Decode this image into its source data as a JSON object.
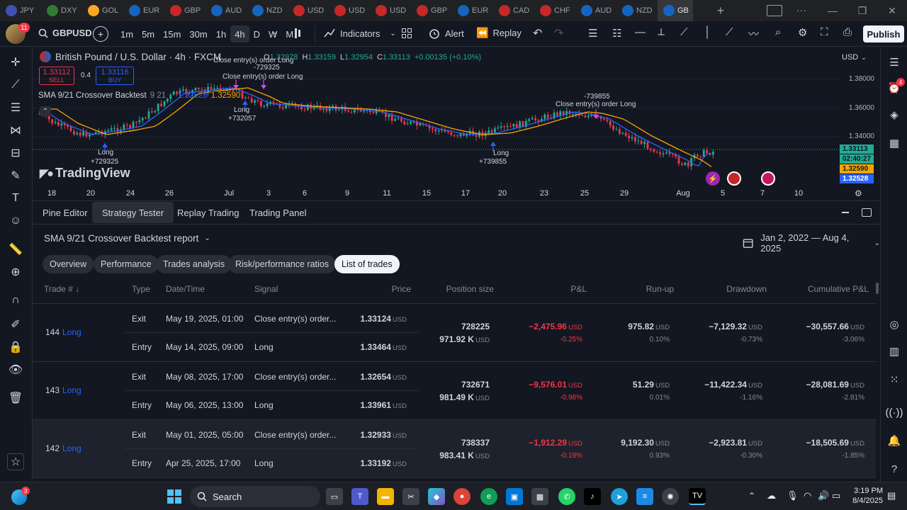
{
  "browser": {
    "tabs": [
      {
        "label": "JPY",
        "color": "#3f51b5"
      },
      {
        "label": "DXY",
        "color": "#2e7d32"
      },
      {
        "label": "GOL",
        "color": "#f9a825"
      },
      {
        "label": "EUR",
        "color": "#1565c0"
      },
      {
        "label": "GBP",
        "color": "#c62828"
      },
      {
        "label": "AUD",
        "color": "#1565c0"
      },
      {
        "label": "NZD",
        "color": "#1565c0"
      },
      {
        "label": "USD",
        "color": "#c62828"
      },
      {
        "label": "USD",
        "color": "#c62828"
      },
      {
        "label": "USD",
        "color": "#c62828"
      },
      {
        "label": "GBP",
        "color": "#c62828"
      },
      {
        "label": "EUR",
        "color": "#1565c0"
      },
      {
        "label": "CAD",
        "color": "#c62828"
      },
      {
        "label": "CHF",
        "color": "#c62828"
      },
      {
        "label": "AUD",
        "color": "#1565c0"
      },
      {
        "label": "NZD",
        "color": "#1565c0"
      },
      {
        "label": "GB",
        "color": "#1565c0"
      }
    ],
    "new_tab": "+",
    "minimize": "—",
    "maximize": "❐",
    "close": "✕"
  },
  "toolbar": {
    "symbol": "GBPUSD",
    "avatar_badge": "11",
    "timeframes": [
      "1m",
      "5m",
      "15m",
      "30m",
      "1h",
      "4h",
      "D",
      "W",
      "M"
    ],
    "active_timeframe": "4h",
    "indicators": "Indicators",
    "alert": "Alert",
    "replay": "Replay",
    "publish": "Publish"
  },
  "chart": {
    "title": "British Pound / U.S. Dollar · 4h · FXCM",
    "ohlc": {
      "o": "1.32978",
      "h": "1.33159",
      "l": "1.32954",
      "c": "1.33113",
      "change": "+0.00135 (+0.10%)"
    },
    "sell_price": "1.33112",
    "sell_label": "SELL",
    "spread": "0.4",
    "buy_price": "1.33116",
    "buy_label": "BUY",
    "strategy_name": "SMA 9/21 Crossover Backtest",
    "strategy_params": "9 21",
    "strategy_value1": "1.32528",
    "strategy_value2": "1.32590",
    "currency": "USD",
    "price_ticks": [
      "1.38000",
      "1.36000",
      "1.34000"
    ],
    "price_badges": [
      {
        "value": "1.33113",
        "color": "#22ab94"
      },
      {
        "value": "02:40:27",
        "color": "#22ab94"
      },
      {
        "value": "1.32590",
        "color": "#f7a600"
      },
      {
        "value": "1.32528",
        "color": "#2962ff"
      }
    ],
    "date_ticks": [
      "18",
      "20",
      "24",
      "26",
      "Jul",
      "3",
      "6",
      "9",
      "11",
      "15",
      "17",
      "20",
      "23",
      "25",
      "29",
      "Aug",
      "5",
      "7",
      "10"
    ],
    "annotations": [
      {
        "text": "Close entry(s) order Long",
        "kind": "close"
      },
      {
        "text": "-729325",
        "kind": "close"
      },
      {
        "text": "Close entry(s) order Long",
        "kind": "close"
      },
      {
        "text": "Long",
        "kind": "long"
      },
      {
        "text": "+732057",
        "kind": "long"
      },
      {
        "text": "Long",
        "kind": "long"
      },
      {
        "text": "+729325",
        "kind": "long"
      },
      {
        "text": "Long",
        "kind": "long"
      },
      {
        "text": "+739855",
        "kind": "long"
      },
      {
        "text": "-739855",
        "kind": "close"
      },
      {
        "text": "Close entry(s) order Long",
        "kind": "close"
      }
    ],
    "watermark": "TradingView"
  },
  "panel": {
    "tabs": [
      "Pine Editor",
      "Strategy Tester",
      "Replay Trading",
      "Trading Panel"
    ],
    "active_tab": "Strategy Tester",
    "report_title": "SMA 9/21 Crossover Backtest report",
    "date_range": "Jan 2, 2022 — Aug 4, 2025",
    "subtabs": [
      "Overview",
      "Performance",
      "Trades analysis",
      "Risk/performance ratios",
      "List of trades"
    ],
    "active_subtab": "List of trades",
    "columns": [
      "Trade # ↓",
      "Type",
      "Date/Time",
      "Signal",
      "Price",
      "Position size",
      "P&L",
      "Run-up",
      "Drawdown",
      "Cumulative P&L"
    ],
    "currency_unit": "USD",
    "trades": [
      {
        "num": "144",
        "side": "Long",
        "exit": {
          "type": "Exit",
          "date": "May 19, 2025, 01:00",
          "signal": "Close entry(s) order...",
          "price": "1.33124"
        },
        "entry": {
          "type": "Entry",
          "date": "May 14, 2025, 09:00",
          "signal": "Long",
          "price": "1.33464"
        },
        "size": "728225",
        "size_value": "971.92 K",
        "pnl": "−2,475.96",
        "pnl_pct": "-0.25%",
        "runup": "975.82",
        "runup_pct": "0.10%",
        "drawdown": "−7,129.32",
        "drawdown_pct": "-0.73%",
        "cum": "−30,557.66",
        "cum_pct": "-3.06%"
      },
      {
        "num": "143",
        "side": "Long",
        "exit": {
          "type": "Exit",
          "date": "May 08, 2025, 17:00",
          "signal": "Close entry(s) order...",
          "price": "1.32654"
        },
        "entry": {
          "type": "Entry",
          "date": "May 06, 2025, 13:00",
          "signal": "Long",
          "price": "1.33961"
        },
        "size": "732671",
        "size_value": "981.49 K",
        "pnl": "−9,576.01",
        "pnl_pct": "-0.98%",
        "runup": "51.29",
        "runup_pct": "0.01%",
        "drawdown": "−11,422.34",
        "drawdown_pct": "-1.16%",
        "cum": "−28,081.69",
        "cum_pct": "-2.81%"
      },
      {
        "num": "142",
        "side": "Long",
        "exit": {
          "type": "Exit",
          "date": "May 01, 2025, 05:00",
          "signal": "Close entry(s) order...",
          "price": "1.32933"
        },
        "entry": {
          "type": "Entry",
          "date": "Apr 25, 2025, 17:00",
          "signal": "Long",
          "price": "1.33192"
        },
        "size": "738337",
        "size_value": "983.41 K",
        "pnl": "−1,912.29",
        "pnl_pct": "-0.19%",
        "runup": "9,192.30",
        "runup_pct": "0.93%",
        "drawdown": "−2,923.81",
        "drawdown_pct": "-0.30%",
        "cum": "−18,505.69",
        "cum_pct": "-1.85%"
      }
    ]
  },
  "taskbar": {
    "search": "Search",
    "badge": "3",
    "time": "3:19 PM",
    "date": "8/4/2025"
  },
  "colors": {
    "background": "#131722",
    "accent": "#2962ff",
    "negative": "#f23645",
    "positive": "#22ab94",
    "sma_fast": "#2962ff",
    "sma_slow": "#f7a600"
  }
}
